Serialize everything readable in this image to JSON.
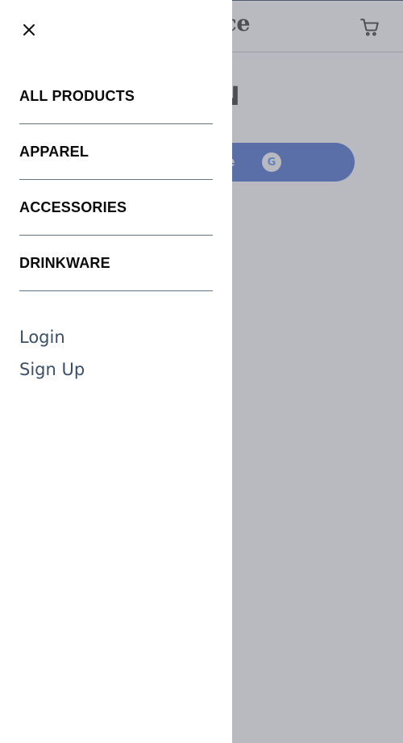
{
  "background": {
    "brand_partial": "ace",
    "heading_partial": "N",
    "google_button_partial": "gle",
    "google_icon_letter": "G"
  },
  "drawer": {
    "nav_items": [
      {
        "label": "ALL PRODUCTS"
      },
      {
        "label": "APPAREL"
      },
      {
        "label": "ACCESSORIES"
      },
      {
        "label": "DRINKWARE"
      }
    ],
    "auth": {
      "login": "Login",
      "signup": "Sign Up"
    }
  },
  "colors": {
    "accent": "#2d59c8",
    "link": "#3a4f68",
    "divider": "#5f7389"
  }
}
